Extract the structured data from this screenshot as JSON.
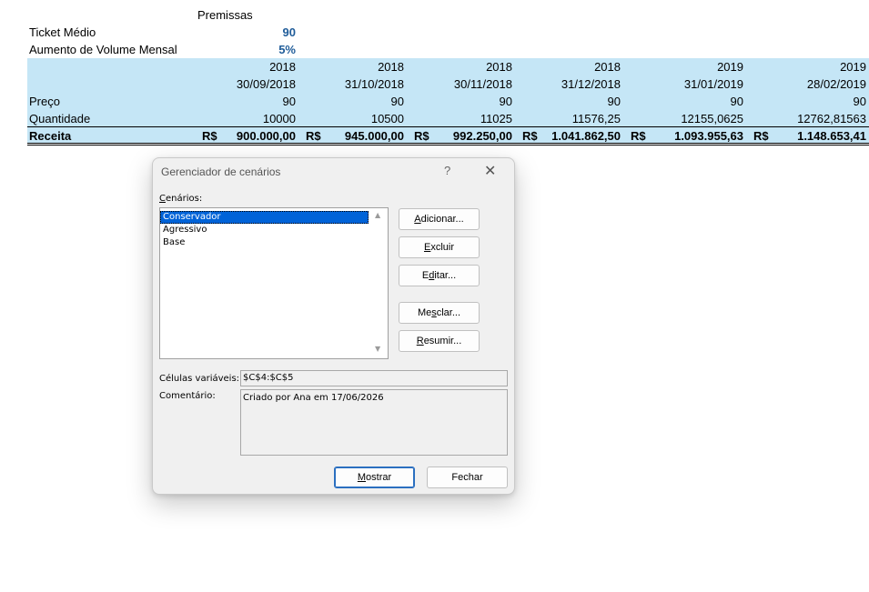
{
  "sheet": {
    "premissas_header": "Premissas",
    "assumptions": [
      {
        "label": "Ticket Médio",
        "value": "90"
      },
      {
        "label": "Aumento de Volume Mensal",
        "value": "5%"
      }
    ],
    "years": [
      "2018",
      "2018",
      "2018",
      "2018",
      "2019",
      "2019"
    ],
    "dates": [
      "30/09/2018",
      "31/10/2018",
      "30/11/2018",
      "31/12/2018",
      "31/01/2019",
      "28/02/2019"
    ],
    "preco": {
      "label": "Preço",
      "values": [
        "90",
        "90",
        "90",
        "90",
        "90",
        "90"
      ]
    },
    "quantidade": {
      "label": "Quantidade",
      "values": [
        "10000",
        "10500",
        "11025",
        "11576,25",
        "12155,0625",
        "12762,81563"
      ]
    },
    "receita": {
      "label": "Receita",
      "currency": "R$",
      "values": [
        "900.000,00",
        "945.000,00",
        "992.250,00",
        "1.041.862,50",
        "1.093.955,63",
        "1.148.653,41"
      ]
    }
  },
  "dialog": {
    "title": "Gerenciador de cenários",
    "help": "?",
    "close": "✕",
    "scenarios_label": "Cenários:",
    "scenarios": [
      "Conservador",
      "Agressivo",
      "Base"
    ],
    "selected_index": 0,
    "buttons": {
      "adicionar": "Adicionar...",
      "excluir": "Excluir",
      "editar": "Editar...",
      "mesclar": "Mesclar...",
      "resumir": "Resumir...",
      "mostrar": "Mostrar",
      "fechar": "Fechar"
    },
    "changing_cells_label": "Células variáveis:",
    "changing_cells_value": "$C$4:$C$5",
    "comment_label": "Comentário:",
    "comment_value": "Criado por Ana em 17/06/2026"
  },
  "colors": {
    "band": "#c5e6f6",
    "input_blue": "#1f5c99",
    "selection": "#0063d8"
  }
}
